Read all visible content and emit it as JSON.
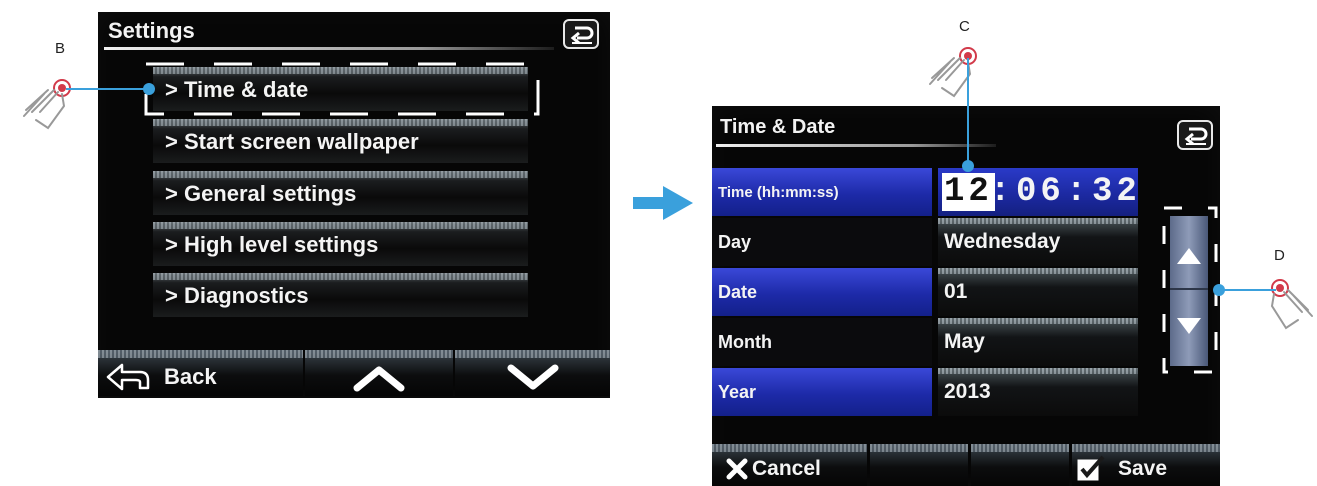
{
  "callouts": {
    "b": "B",
    "c": "C",
    "d": "D"
  },
  "settings_screen": {
    "title": "Settings",
    "menu": [
      {
        "label": "> Time & date"
      },
      {
        "label": "> Start screen wallpaper"
      },
      {
        "label": "> General settings"
      },
      {
        "label": "> High level settings"
      },
      {
        "label": "> Diagnostics"
      }
    ],
    "footer": {
      "back_label": "Back"
    }
  },
  "time_date_screen": {
    "title": "Time & Date",
    "rows": [
      {
        "label": "Time (hh:mm:ss)",
        "value": ""
      },
      {
        "label": "Day",
        "value": "Wednesday"
      },
      {
        "label": "Date",
        "value": "01"
      },
      {
        "label": "Month",
        "value": "May"
      },
      {
        "label": "Year",
        "value": "2013"
      }
    ],
    "time": {
      "hh": "12",
      "sep1": ":",
      "mm": "06",
      "sep2": ":",
      "ss": "32"
    },
    "footer": {
      "cancel_label": "Cancel",
      "save_label": "Save"
    }
  },
  "colors": {
    "arrow": "#3aa0dc",
    "callout_line": "#3aa0dc",
    "highlight_blue": "#1d2aa8",
    "touch_ring": "#d23a4a"
  }
}
